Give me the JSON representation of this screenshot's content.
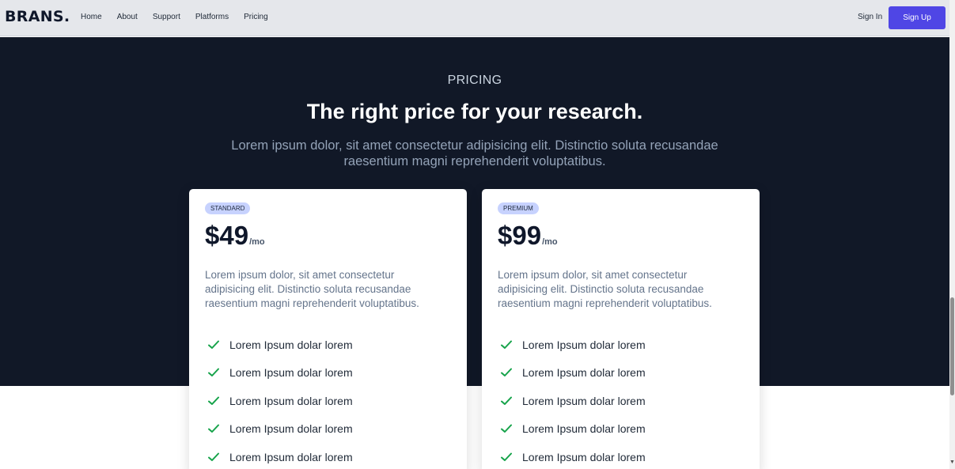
{
  "brand": {
    "logo": "BRANS."
  },
  "nav": {
    "links": [
      "Home",
      "About",
      "Support",
      "Platforms",
      "Pricing"
    ],
    "signin": "Sign In",
    "signup": "Sign Up"
  },
  "hero": {
    "eyebrow": "PRICING",
    "headline": "The right price for your research.",
    "subhead": "Lorem ipsum dolor, sit amet consectetur adipisicing elit. Distinctio soluta recusandae raesentium magni reprehenderit voluptatibus."
  },
  "plans": [
    {
      "badge": "STANDARD",
      "price": "$49",
      "period": "/mo",
      "description": "Lorem ipsum dolor, sit amet consectetur adipisicing elit. Distinctio soluta recusandae raesentium magni reprehenderit voluptatibus.",
      "features": [
        "Lorem Ipsum dolar lorem",
        "Lorem Ipsum dolar lorem",
        "Lorem Ipsum dolar lorem",
        "Lorem Ipsum dolar lorem",
        "Lorem Ipsum dolar lorem"
      ]
    },
    {
      "badge": "PREMIUM",
      "price": "$99",
      "period": "/mo",
      "description": "Lorem ipsum dolor, sit amet consectetur adipisicing elit. Distinctio soluta recusandae raesentium magni reprehenderit voluptatibus.",
      "features": [
        "Lorem Ipsum dolar lorem",
        "Lorem Ipsum dolar lorem",
        "Lorem Ipsum dolar lorem",
        "Lorem Ipsum dolar lorem",
        "Lorem Ipsum dolar lorem"
      ]
    }
  ],
  "icons": {
    "feature": "check-icon",
    "scroll": "scroll-down-arrow-icon"
  },
  "colors": {
    "accent": "#4f46e5",
    "hero_bg": "#111827",
    "check": "#16a34a",
    "badge_bg": "#c7d2fe"
  },
  "scroll": {
    "position_fraction": 0.66
  }
}
